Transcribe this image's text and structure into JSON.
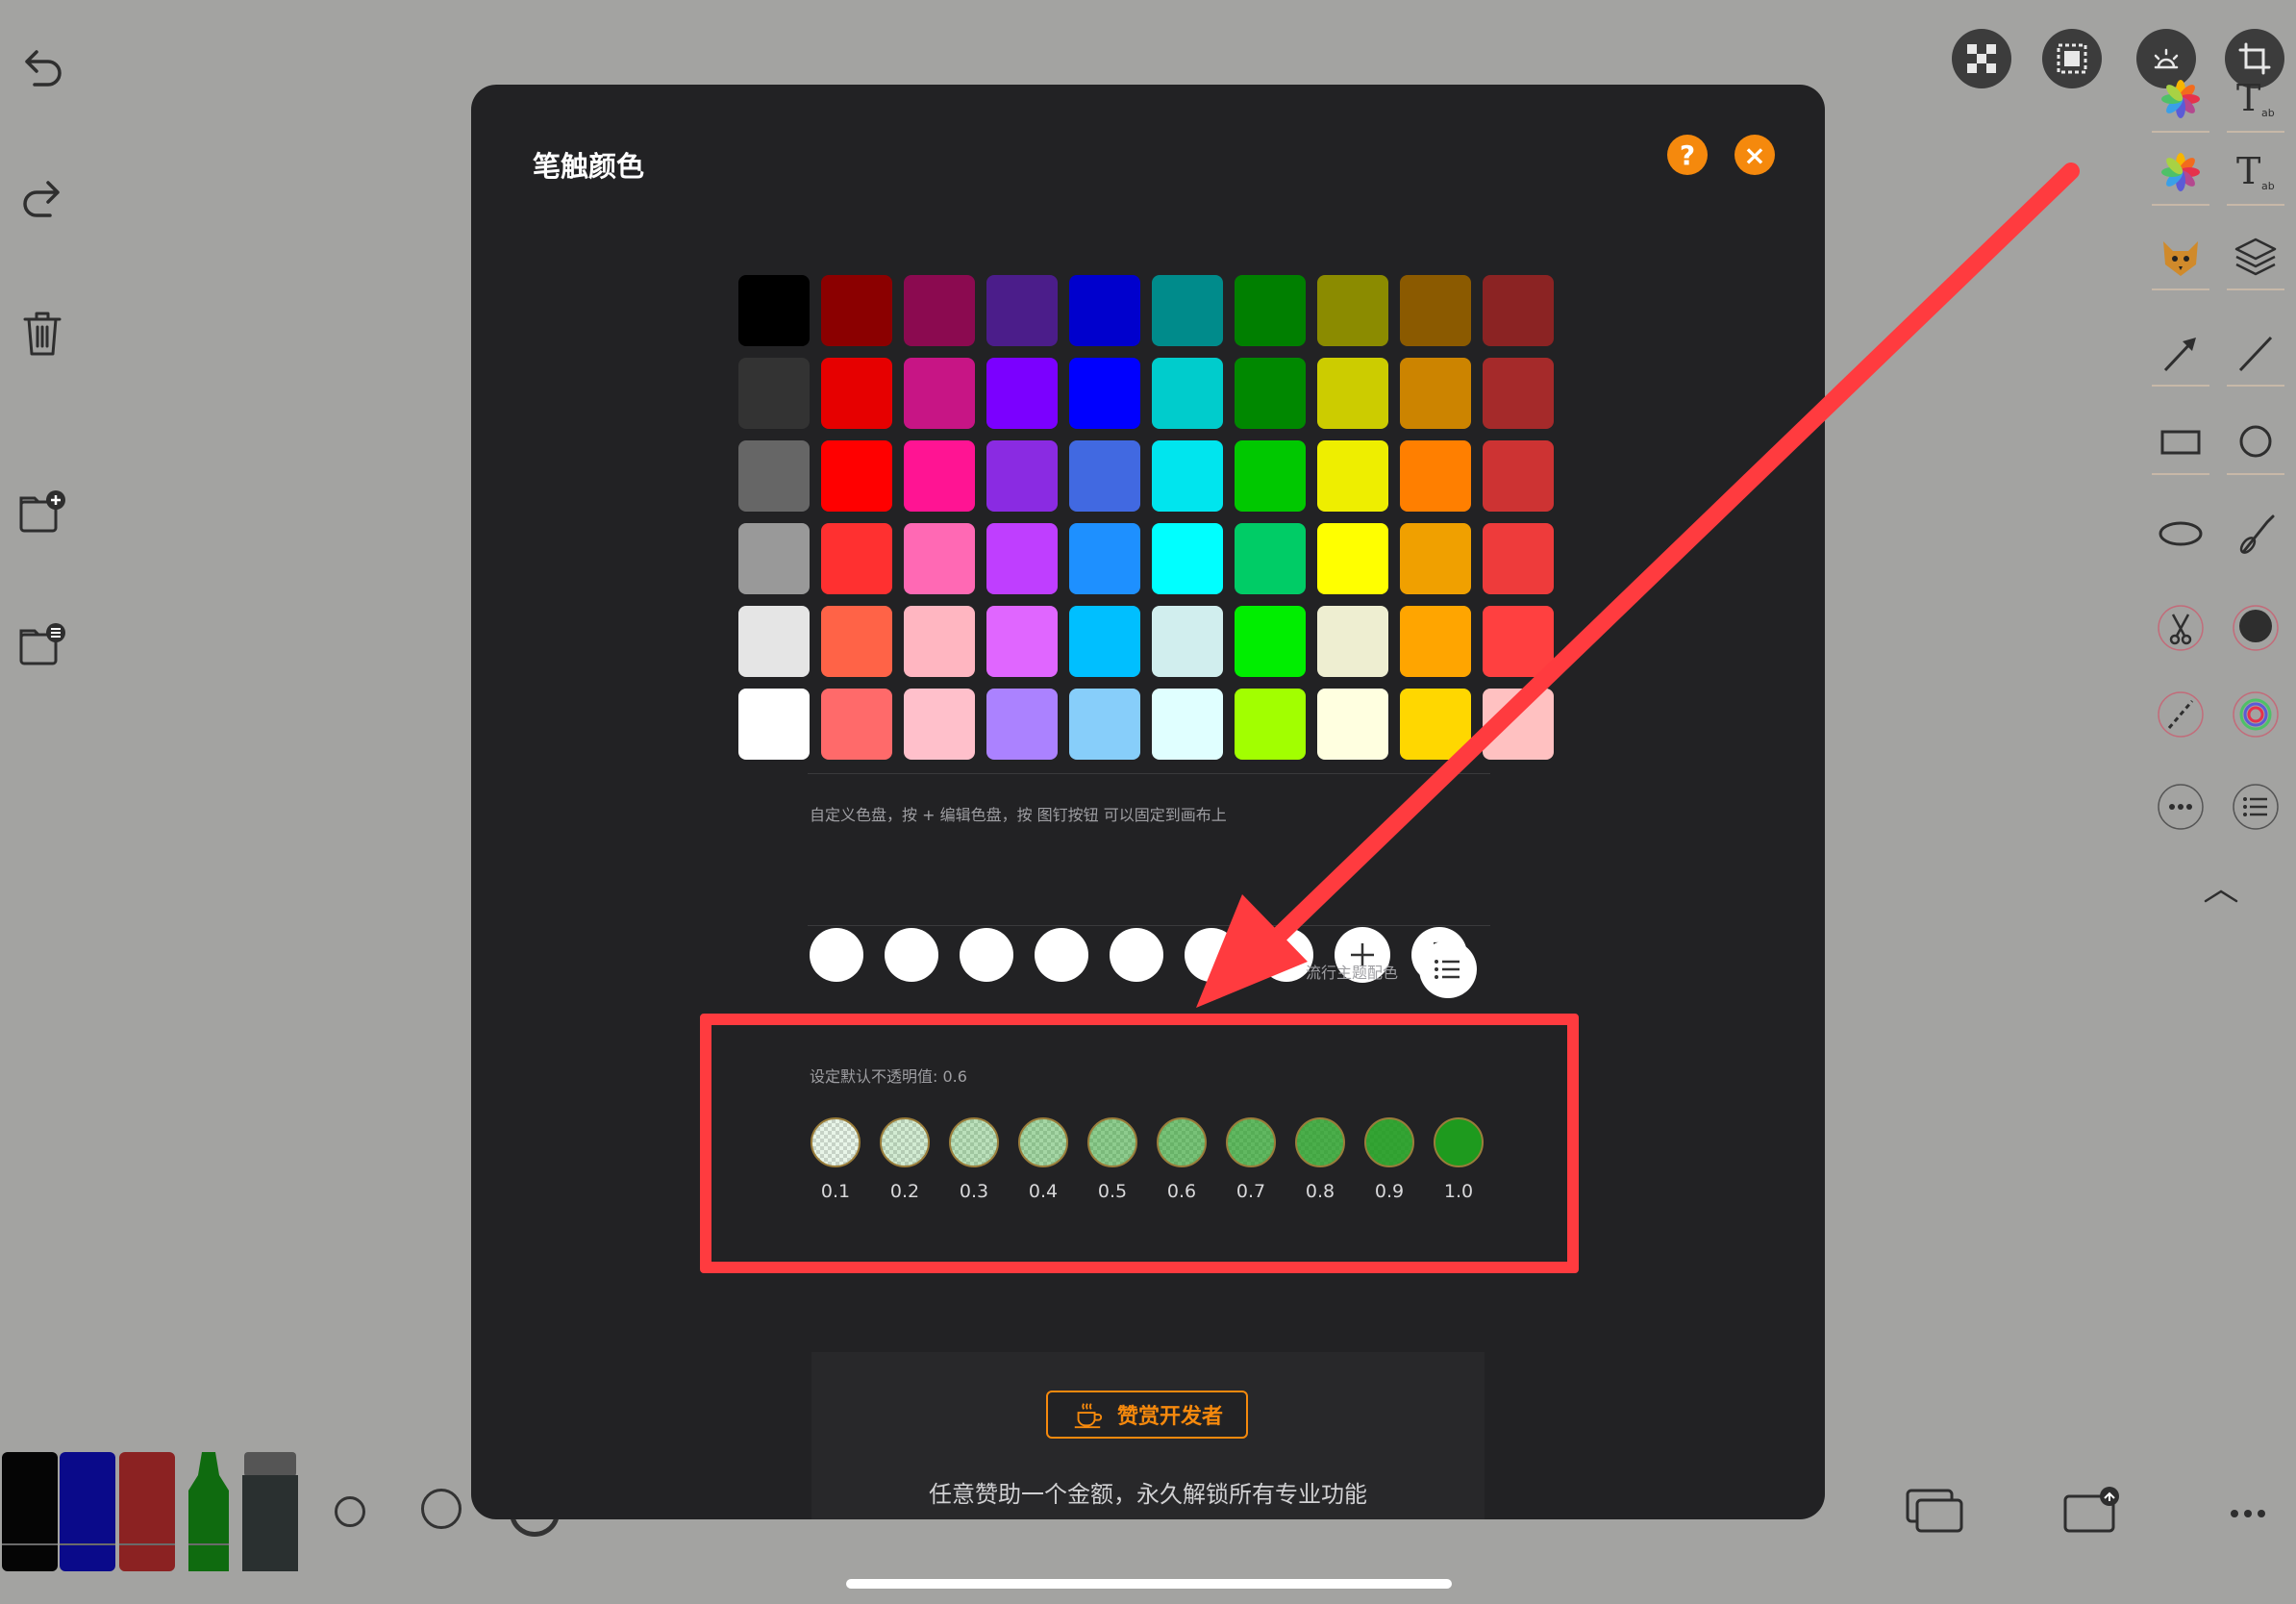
{
  "modal": {
    "title": "笔触颜色",
    "help_label": "?",
    "close_label": "×",
    "swatches": [
      "#000000",
      "#8b0000",
      "#8b0a50",
      "#4b1d8a",
      "#0000cd",
      "#008b8b",
      "#007f00",
      "#8b8b00",
      "#8b5a00",
      "#8b2323",
      "#333333",
      "#e60000",
      "#c71585",
      "#7b00ff",
      "#0000ff",
      "#00cccc",
      "#008800",
      "#cccc00",
      "#cc8400",
      "#a52a2a",
      "#666666",
      "#ff0000",
      "#ff1493",
      "#8a2be2",
      "#4169e1",
      "#00e5ee",
      "#00c800",
      "#eeee00",
      "#ff7f00",
      "#cd3333",
      "#999999",
      "#ff3030",
      "#ff69b4",
      "#bf3eff",
      "#1e90ff",
      "#00ffff",
      "#00cc66",
      "#ffff00",
      "#f0a000",
      "#ee3b3b",
      "#e5e5e5",
      "#ff6347",
      "#ffb6c1",
      "#e066ff",
      "#00bfff",
      "#d1eeee",
      "#00ee00",
      "#eeeed1",
      "#ffa500",
      "#ff4040",
      "#ffffff",
      "#ff6a6a",
      "#ffc0cb",
      "#ab82ff",
      "#87cefa",
      "#e0ffff",
      "#a2ff00",
      "#ffffe0",
      "#ffd700",
      "#ffc1c1"
    ],
    "custom_hint": "自定义色盘，按 + 编辑色盘，按 图钉按钮 可以固定到画布上",
    "theme_label": "流行主题配色",
    "opacity_label": "设定默认不透明值: 0.6",
    "opacity_values": [
      "0.1",
      "0.2",
      "0.3",
      "0.4",
      "0.5",
      "0.6",
      "0.7",
      "0.8",
      "0.9",
      "1.0"
    ],
    "opacity_levels": [
      0.1,
      0.2,
      0.3,
      0.4,
      0.5,
      0.6,
      0.7,
      0.8,
      0.9,
      1.0
    ],
    "sponsor_button": "赞赏开发者",
    "sponsor_text": "任意赞助一个金额，永久解锁所有专业功能"
  },
  "colors": {
    "accent": "#f5890d",
    "annotation": "#ff3b3f",
    "opacity_green": "#1e9a1e"
  },
  "icons": {
    "left": [
      "undo-icon",
      "redo-icon",
      "trash-icon",
      "new-folder-icon",
      "folder-list-icon"
    ],
    "top_right": [
      "checkerboard-icon",
      "select-frame-icon",
      "sun-icon",
      "crop-icon"
    ],
    "right": [
      "photos-icon",
      "text-icon",
      "photos-icon",
      "text-icon",
      "fox-sticker-icon",
      "layers-icon",
      "arrow-icon",
      "line-icon",
      "rectangle-icon",
      "circle-icon",
      "ellipse-icon",
      "brush-icon",
      "scissors-icon",
      "color-dot-icon",
      "dashed-line-icon",
      "color-wheel-icon",
      "more-icon",
      "list-icon",
      "chevron-up-icon"
    ],
    "bottom_right": [
      "windows-icon",
      "share-icon",
      "more-icon"
    ]
  }
}
